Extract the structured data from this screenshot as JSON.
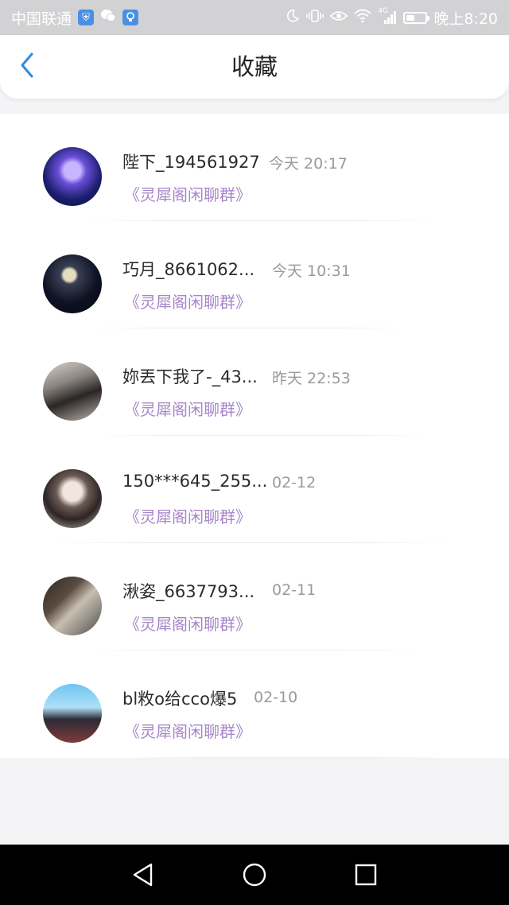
{
  "status_bar": {
    "carrier": "中国联通",
    "time": "晚上8:20",
    "signal_label": "4G",
    "battery_level": 0.45,
    "left_icons": [
      "shield-app-icon",
      "wechat-icon",
      "bulb-app-icon"
    ],
    "right_icons": [
      "moon-icon",
      "vibrate-icon",
      "eye-icon",
      "wifi-icon",
      "signal-icon",
      "battery-icon"
    ]
  },
  "header": {
    "title": "收藏",
    "back_icon": "chevron-left-icon",
    "accent_color": "#2b8ce0"
  },
  "favorites": [
    {
      "name": "陛下_194561927",
      "time": "今天 20:17",
      "group": "《灵犀阁闲聊群》"
    },
    {
      "name": "巧月_8661062...",
      "time": "今天 10:31",
      "group": "《灵犀阁闲聊群》"
    },
    {
      "name": "妳丟下我了-_43...",
      "time": "昨天 22:53",
      "group": "《灵犀阁闲聊群》"
    },
    {
      "name": "150***645_255...",
      "time": "02-12",
      "group": "《灵犀阁闲聊群》"
    },
    {
      "name": "湫姿_6637793...",
      "time": "02-11",
      "group": "《灵犀阁闲聊群》"
    },
    {
      "name": "bl敉o给cco爆5",
      "time": "02-10",
      "group": "《灵犀阁闲聊群》"
    }
  ],
  "nav_bar": {
    "icons": [
      "back-triangle-icon",
      "home-circle-icon",
      "recents-square-icon"
    ]
  },
  "colors": {
    "group_text": "#a785c8",
    "time_text": "#9a9a9a",
    "status_bar_bg": "#d2d2d4"
  }
}
